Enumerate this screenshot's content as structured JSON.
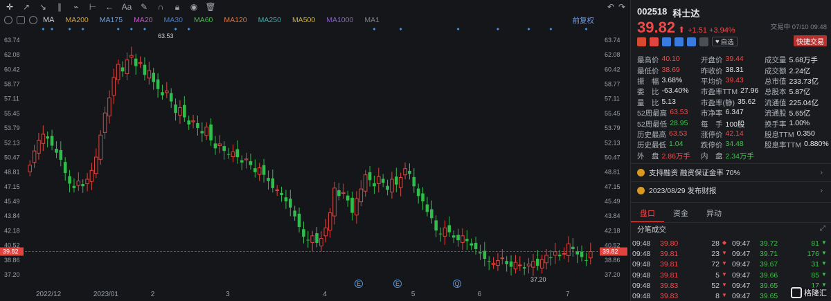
{
  "toolbar": {
    "icons": [
      "crosshair-icon",
      "line-tool-icon",
      "ray-tool-icon",
      "channel-tool-icon",
      "wave-tool-icon",
      "fib-tool-icon",
      "arrow-tool-icon",
      "text-tool-icon",
      "brush-tool-icon",
      "magnet-icon",
      "lock-icon",
      "eye-icon",
      "delete-icon",
      "undo-icon",
      "redo-icon"
    ],
    "text_tool": "Aa"
  },
  "ma_bar": {
    "indicator": "MA",
    "items": [
      {
        "label": "MA200",
        "color": "#d3a33b"
      },
      {
        "label": "MA175",
        "color": "#6aa0e8"
      },
      {
        "label": "MA20",
        "color": "#c455c9"
      },
      {
        "label": "MA30",
        "color": "#3e7bd8"
      },
      {
        "label": "MA60",
        "color": "#3fbf4a"
      },
      {
        "label": "MA120",
        "color": "#e0733a"
      },
      {
        "label": "MA250",
        "color": "#36b0a8"
      },
      {
        "label": "MA500",
        "color": "#c9ad3a"
      },
      {
        "label": "MA1000",
        "color": "#8a5fd0"
      },
      {
        "label": "MA1",
        "color": "#7c8088"
      }
    ],
    "adjust": "前复权"
  },
  "chart": {
    "y_ticks": [
      "63.74",
      "62.08",
      "60.42",
      "58.77",
      "57.11",
      "55.45",
      "53.79",
      "52.13",
      "50.47",
      "48.81",
      "47.15",
      "45.49",
      "43.84",
      "42.18",
      "40.52",
      "38.86",
      "37.20"
    ],
    "x_labels": [
      "2022/12",
      "2023/01",
      "2",
      "3",
      "4",
      "5",
      "6",
      "7"
    ],
    "current_price": "39.82",
    "high_annotation": "63.53",
    "low_annotation": "37.20",
    "event_marker": "E",
    "event_marker_alt": "Q",
    "colors": {
      "up": "#e0443f",
      "down": "#2fbe4b",
      "marker": "#4a90e2",
      "current": "#e0443f"
    }
  },
  "chart_data": {
    "type": "candlestick",
    "ylim": [
      37.2,
      63.74
    ],
    "x_labels": [
      "2022/12",
      "2023/01",
      "2",
      "3",
      "4",
      "5",
      "6",
      "7"
    ],
    "annotations": {
      "high": 63.53,
      "low": 37.2,
      "last": 39.82
    },
    "series": [
      {
        "name": "2022/12",
        "values": [
          49.6,
          51.2,
          52.4,
          53.1,
          52.6,
          51.8,
          51.0,
          50.2,
          48.7,
          47.5,
          47.0,
          47.8,
          47.2,
          48.0,
          49.0
        ]
      },
      {
        "name": "2023/01",
        "values": [
          50.5,
          53.0,
          55.5,
          57.2,
          59.5,
          61.0,
          60.2,
          61.5,
          62.0,
          60.8,
          61.2,
          59.8,
          60.3
        ]
      },
      {
        "name": "2",
        "values": [
          59.0,
          58.2,
          57.5,
          58.0,
          56.8,
          55.5,
          56.1,
          55.0,
          54.2,
          54.6,
          53.8,
          53.2,
          53.9,
          52.4,
          51.5,
          52.0,
          51.2
        ]
      },
      {
        "name": "3",
        "values": [
          50.8,
          51.1,
          50.5,
          49.9,
          50.3,
          49.6,
          48.8,
          49.3,
          48.5,
          47.8,
          47.0,
          46.8,
          46.2,
          45.5,
          44.8,
          43.8,
          42.6,
          41.5,
          41.1,
          41.6,
          40.8,
          41.3
        ]
      },
      {
        "name": "4",
        "values": [
          42.5,
          44.2,
          47.0,
          46.1,
          46.5,
          45.6,
          44.2,
          45.8,
          46.9,
          48.5,
          47.9,
          47.2,
          48.3,
          47.6,
          46.8,
          48.0,
          47.4,
          48.2,
          49.2,
          48.6
        ]
      },
      {
        "name": "5",
        "values": [
          47.2,
          46.1,
          45.5,
          44.3,
          43.6,
          42.2,
          41.8,
          42.5,
          42.0,
          41.4,
          41.1,
          41.6,
          41.0,
          40.5,
          40.1
        ]
      },
      {
        "name": "6",
        "values": [
          39.6,
          39.0,
          38.7,
          38.5,
          38.8,
          39.1,
          38.4,
          38.1,
          38.6,
          38.3,
          37.9,
          38.4,
          38.7,
          38.2,
          38.9,
          39.4,
          39.1,
          39.8,
          39.3,
          39.6
        ]
      },
      {
        "name": "7",
        "values": [
          40.7,
          40.1,
          39.5,
          39.2,
          38.8,
          39.82
        ]
      }
    ]
  },
  "stock": {
    "code": "002518",
    "name": "科士达",
    "price": "39.82",
    "arrow": "⬆",
    "change": "+1.51 +3.94%",
    "trade_time": "交易中 07/10 09:48",
    "fav_label": "自选",
    "quick_trade": "快捷交易"
  },
  "stats": [
    [
      {
        "l": "最高价",
        "v": "40.10",
        "c": "red"
      },
      {
        "l": "开盘价",
        "v": "39.44",
        "c": "red"
      },
      {
        "l": "成交量",
        "v": "5.68万手",
        "c": ""
      }
    ],
    [
      {
        "l": "最低价",
        "v": "38.69",
        "c": "red"
      },
      {
        "l": "昨收价",
        "v": "38.31",
        "c": ""
      },
      {
        "l": "成交额",
        "v": "2.24亿",
        "c": ""
      }
    ],
    [
      {
        "l": "振　幅",
        "v": "3.68%",
        "c": ""
      },
      {
        "l": "平均价",
        "v": "39.43",
        "c": "red"
      },
      {
        "l": "总市值",
        "v": "233.73亿",
        "c": ""
      }
    ],
    [
      {
        "l": "委　比",
        "v": "-63.40%",
        "c": ""
      },
      {
        "l": "市盈率TTM",
        "v": "27.96",
        "c": ""
      },
      {
        "l": "总股本",
        "v": "5.87亿",
        "c": ""
      }
    ],
    [
      {
        "l": "量　比",
        "v": "5.13",
        "c": ""
      },
      {
        "l": "市盈率(静)",
        "v": "35.62",
        "c": ""
      },
      {
        "l": "流通值",
        "v": "225.04亿",
        "c": ""
      }
    ],
    [
      {
        "l": "52周最高",
        "v": "63.53",
        "c": "red"
      },
      {
        "l": "市净率",
        "v": "6.347",
        "c": ""
      },
      {
        "l": "流通股",
        "v": "5.65亿",
        "c": ""
      }
    ],
    [
      {
        "l": "52周最低",
        "v": "28.95",
        "c": "green"
      },
      {
        "l": "每　手",
        "v": "100股",
        "c": ""
      },
      {
        "l": "换手率",
        "v": "1.00%",
        "c": ""
      }
    ],
    [
      {
        "l": "历史最高",
        "v": "63.53",
        "c": "red"
      },
      {
        "l": "涨停价",
        "v": "42.14",
        "c": "red"
      },
      {
        "l": "股息TTM",
        "v": "0.350",
        "c": ""
      }
    ],
    [
      {
        "l": "历史最低",
        "v": "1.04",
        "c": "green"
      },
      {
        "l": "跌停价",
        "v": "34.48",
        "c": "green"
      },
      {
        "l": "股息率TTM",
        "v": "0.880%",
        "c": ""
      }
    ],
    [
      {
        "l": "外　盘",
        "v": "2.86万手",
        "c": "red"
      },
      {
        "l": "内　盘",
        "v": "2.34万手",
        "c": "green"
      },
      {
        "l": "",
        "v": "",
        "c": ""
      }
    ]
  ],
  "notices": [
    {
      "text": "支持融资 融资保证金率 70%",
      "arrow": "›"
    },
    {
      "text": "2023/08/29  发布财报",
      "arrow": "›"
    }
  ],
  "tabs": [
    "盘口",
    "资金",
    "异动"
  ],
  "ticks_title": "分笔成交",
  "ticks_expand": "⤢",
  "ticks": [
    [
      {
        "t": "09:48",
        "p": "39.80",
        "v": "28",
        "d": "◆",
        "c": "red"
      },
      {
        "t": "09:47",
        "p": "39.72",
        "v": "81",
        "d": "▼",
        "c": "green"
      }
    ],
    [
      {
        "t": "09:48",
        "p": "39.81",
        "v": "23",
        "d": "▼",
        "c": "red"
      },
      {
        "t": "09:47",
        "p": "39.71",
        "v": "176",
        "d": "▼",
        "c": "green"
      }
    ],
    [
      {
        "t": "09:48",
        "p": "39.81",
        "v": "72",
        "d": "▼",
        "c": "red"
      },
      {
        "t": "09:47",
        "p": "39.67",
        "v": "31",
        "d": "▼",
        "c": "green"
      }
    ],
    [
      {
        "t": "09:48",
        "p": "39.81",
        "v": "5",
        "d": "▼",
        "c": "red"
      },
      {
        "t": "09:47",
        "p": "39.66",
        "v": "85",
        "d": "▼",
        "c": "green"
      }
    ],
    [
      {
        "t": "09:48",
        "p": "39.83",
        "v": "52",
        "d": "▼",
        "c": "red"
      },
      {
        "t": "09:47",
        "p": "39.65",
        "v": "17",
        "d": "▼",
        "c": "green"
      }
    ],
    [
      {
        "t": "09:48",
        "p": "39.83",
        "v": "8",
        "d": "▼",
        "c": "red"
      },
      {
        "t": "09:47",
        "p": "39.65",
        "v": "",
        "d": "",
        "c": "green"
      }
    ]
  ],
  "watermark": "格隆汇"
}
